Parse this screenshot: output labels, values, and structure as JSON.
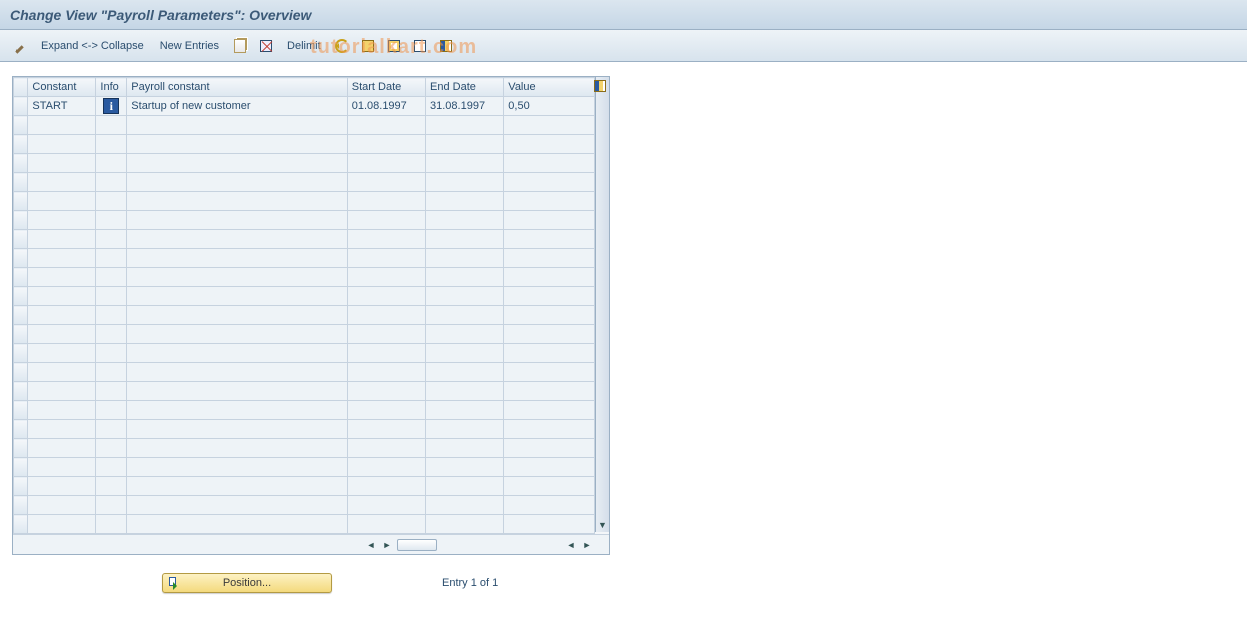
{
  "title": "Change View \"Payroll Parameters\": Overview",
  "watermark": "tutorialkart.com",
  "toolbar": {
    "expand_collapse": "Expand <-> Collapse",
    "new_entries": "New Entries",
    "delimit": "Delimit"
  },
  "grid": {
    "columns": {
      "constant": "Constant",
      "info": "Info",
      "payroll_constant": "Payroll constant",
      "start_date": "Start Date",
      "end_date": "End Date",
      "value": "Value"
    },
    "rows": [
      {
        "constant": "START",
        "info": "i",
        "payroll_constant": "Startup of new customer",
        "start_date": "01.08.1997",
        "end_date": "31.08.1997",
        "value": "0,50"
      }
    ],
    "empty_row_count": 22
  },
  "footer": {
    "position_label": "Position...",
    "entry_label": "Entry 1 of 1"
  }
}
